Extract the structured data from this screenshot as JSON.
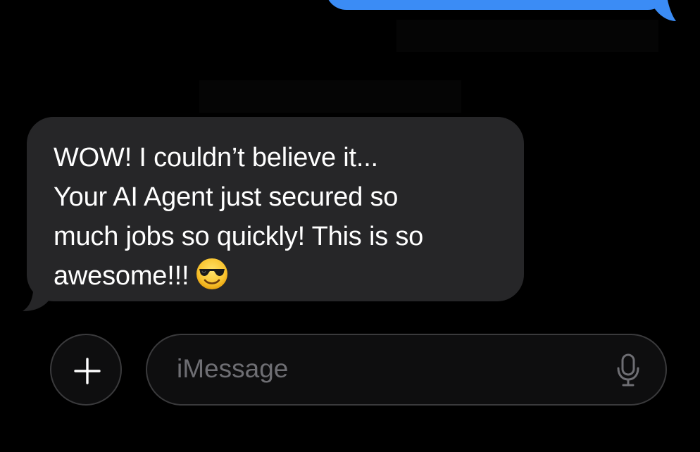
{
  "conversation": {
    "sent_message": {
      "color": "#3b8cf5"
    },
    "received_message": {
      "lines": [
        "WOW! I couldn’t believe it...",
        "Your AI Agent just secured so",
        "much jobs so quickly! This is so",
        "awesome!!!"
      ],
      "emoji": "smiling-face-with-sunglasses",
      "bubble_color": "#262628"
    }
  },
  "composer": {
    "plus_icon": "plus-icon",
    "placeholder": "iMessage",
    "mic_icon": "microphone-icon"
  }
}
